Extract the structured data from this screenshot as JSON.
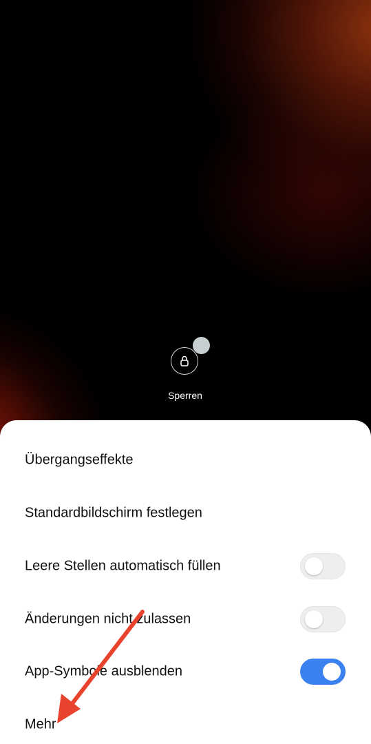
{
  "lock": {
    "label": "Sperren"
  },
  "menu": {
    "items": [
      {
        "label": "Übergangseffekte",
        "has_toggle": false
      },
      {
        "label": "Standardbildschirm festlegen",
        "has_toggle": false
      },
      {
        "label": "Leere Stellen automatisch füllen",
        "has_toggle": true,
        "enabled": false
      },
      {
        "label": "Änderungen nicht zulassen",
        "has_toggle": true,
        "enabled": false
      },
      {
        "label": "App-Symbole ausblenden",
        "has_toggle": true,
        "enabled": true
      },
      {
        "label": "Mehr",
        "has_toggle": false
      }
    ]
  },
  "colors": {
    "toggle_on": "#3b82f0",
    "toggle_off": "#eeeeee",
    "annotation_arrow": "#e8432c"
  }
}
